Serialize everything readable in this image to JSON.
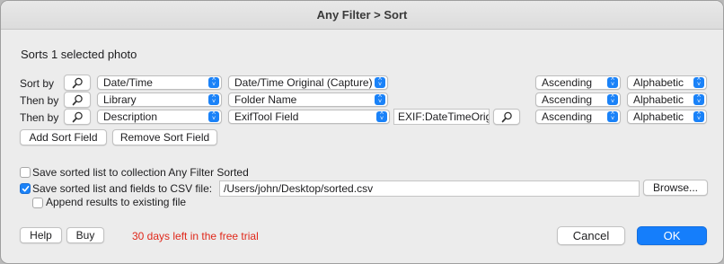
{
  "window": {
    "title": "Any Filter > Sort"
  },
  "header": {
    "subtitle": "Sorts 1 selected photo"
  },
  "sort_rows": [
    {
      "label": "Sort by",
      "field": "Date/Time",
      "subfield": "Date/Time Original (Capture)",
      "tag": "",
      "order": "Ascending",
      "mode": "Alphabetic"
    },
    {
      "label": "Then by",
      "field": "Library",
      "subfield": "Folder Name",
      "tag": "",
      "order": "Ascending",
      "mode": "Alphabetic"
    },
    {
      "label": "Then by",
      "field": "Description",
      "subfield": "ExifTool Field",
      "tag": "EXIF:DateTimeOrig",
      "order": "Ascending",
      "mode": "Alphabetic"
    }
  ],
  "buttons": {
    "add_sort_field": "Add Sort Field",
    "remove_sort_field": "Remove Sort Field",
    "browse": "Browse...",
    "help": "Help",
    "buy": "Buy",
    "cancel": "Cancel",
    "ok": "OK"
  },
  "options": {
    "save_collection": {
      "label": "Save sorted list to collection Any Filter Sorted",
      "checked": false
    },
    "save_csv": {
      "label": "Save sorted list and fields to CSV file:",
      "checked": true
    },
    "csv_path": "/Users/john/Desktop/sorted.csv",
    "append": {
      "label": "Append results to existing file",
      "checked": false
    }
  },
  "trial_text": "30 days left in the free trial",
  "colors": {
    "accent": "#1a82f8",
    "trial": "#e0281b"
  },
  "icons": {
    "search": "magnifier-icon",
    "popup": "up-down-chevron-icon",
    "check": "checkmark-icon"
  }
}
